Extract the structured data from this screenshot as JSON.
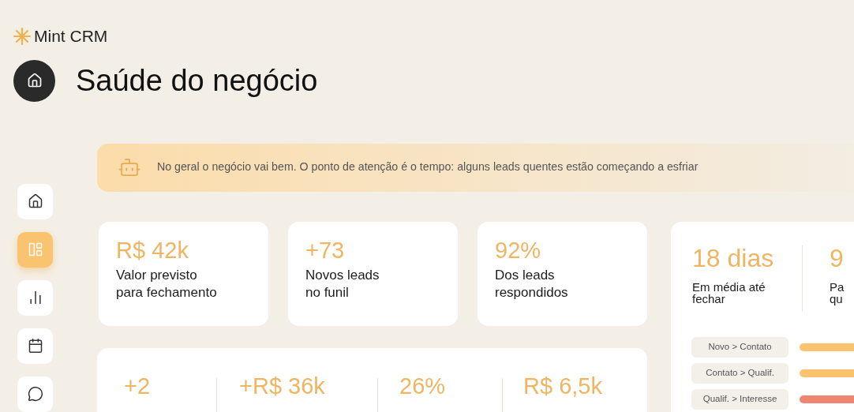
{
  "brand": {
    "name": "Mint CRM"
  },
  "page": {
    "title": "Saúde do negócio"
  },
  "sidebar": {
    "items": [
      {
        "selected": false
      },
      {
        "selected": true
      },
      {
        "selected": false
      },
      {
        "selected": false
      },
      {
        "selected": false
      }
    ]
  },
  "insight": {
    "text": "No geral o negócio vai bem. O ponto de atenção é o tempo: alguns leads quentes estão começando a esfriar"
  },
  "kpis": [
    {
      "value": "R$ 42k",
      "label": [
        "Valor previsto",
        "para fechamento"
      ]
    },
    {
      "value": "+73",
      "label": [
        "Novos leads",
        "no funil"
      ]
    },
    {
      "value": "92%",
      "label": [
        "Dos leads",
        "respondidos"
      ]
    }
  ],
  "time_card": {
    "stats": [
      {
        "value": "18 dias",
        "label": [
          "Em média até",
          "fechar"
        ]
      },
      {
        "value": "9",
        "label": [
          "Pa",
          "qu"
        ]
      }
    ],
    "stages": [
      {
        "label": "Novo > Contato",
        "color": "#f9c36f"
      },
      {
        "label": "Contato > Qualif.",
        "color": "#f9c36f"
      },
      {
        "label": "Qualif. > Interesse",
        "color": "#ef8672"
      }
    ]
  },
  "summary": {
    "stats": [
      {
        "value": "+2"
      },
      {
        "value": "+R$ 36k"
      },
      {
        "value": "26%"
      },
      {
        "value": "R$ 6,5k"
      }
    ]
  }
}
